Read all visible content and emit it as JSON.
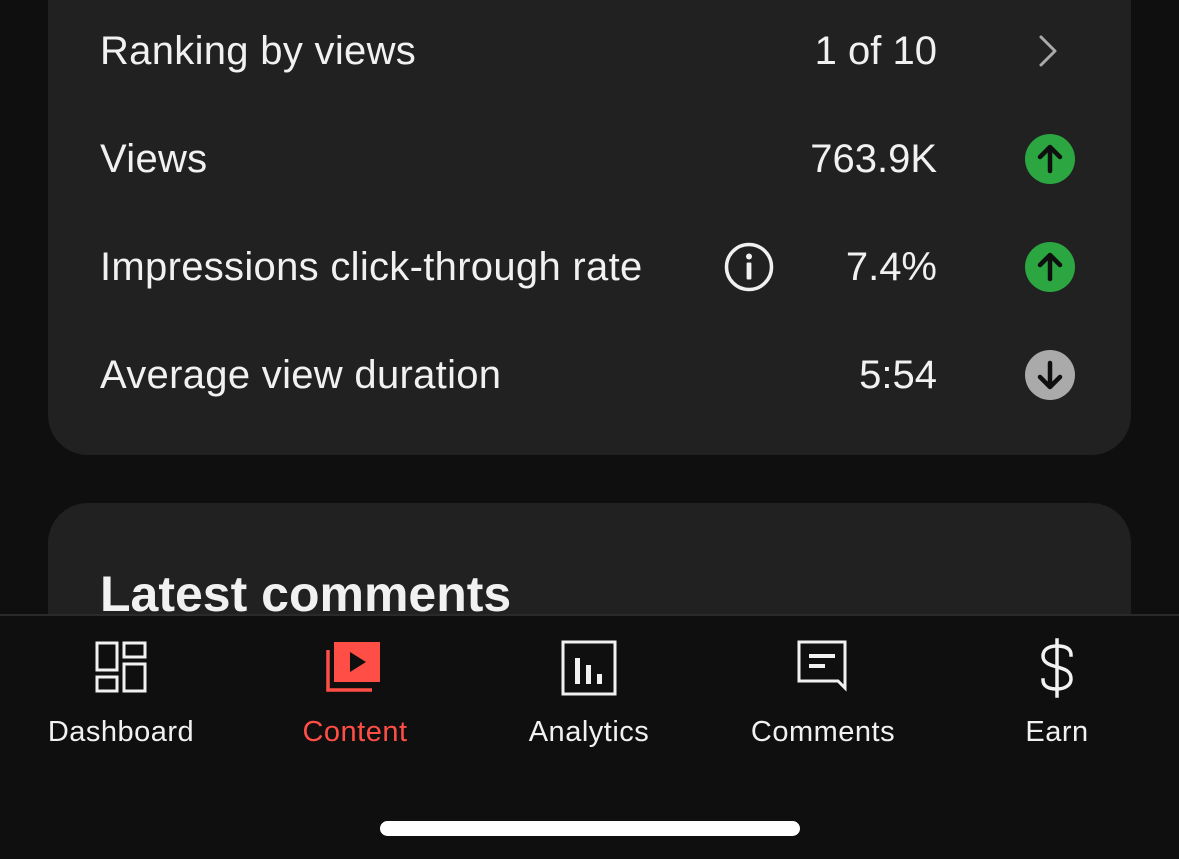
{
  "stats": {
    "ranking": {
      "label": "Ranking by views",
      "value": "1 of 10"
    },
    "views": {
      "label": "Views",
      "value": "763.9K",
      "trend": "up"
    },
    "ctr": {
      "label": "Impressions click-through rate",
      "value": "7.4%",
      "trend": "up"
    },
    "avg_duration": {
      "label": "Average view duration",
      "value": "5:54",
      "trend": "down"
    }
  },
  "comments_section": {
    "title": "Latest comments"
  },
  "nav": {
    "items": [
      {
        "label": "Dashboard",
        "icon": "dashboard-icon"
      },
      {
        "label": "Content",
        "icon": "content-icon",
        "active": true
      },
      {
        "label": "Analytics",
        "icon": "analytics-icon"
      },
      {
        "label": "Comments",
        "icon": "comments-icon"
      },
      {
        "label": "Earn",
        "icon": "dollar-icon"
      }
    ]
  },
  "colors": {
    "accent": "#ff4e45",
    "trend_up": "#2ba640",
    "trend_down": "#aaaaaa",
    "card_bg": "#212121",
    "page_bg": "#0f0f0f"
  }
}
